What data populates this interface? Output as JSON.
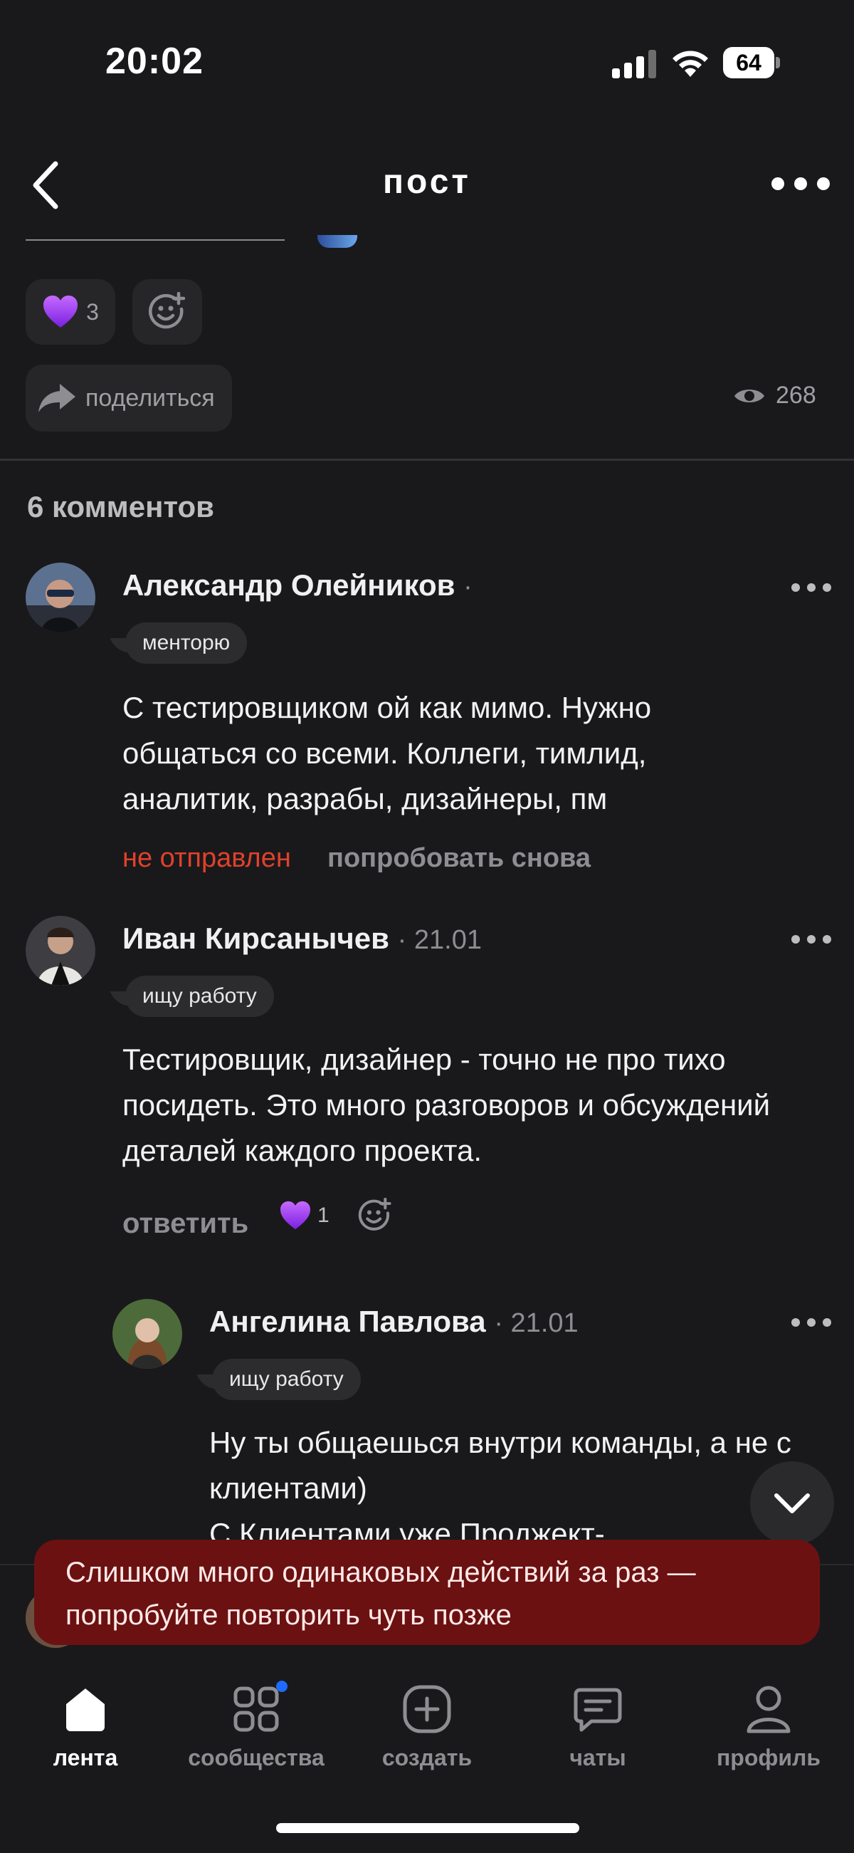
{
  "status_bar": {
    "time": "20:02",
    "battery": "64"
  },
  "header": {
    "title": "пост"
  },
  "post": {
    "likes": "3",
    "share_label": "поделиться",
    "views": "268"
  },
  "comments_section": {
    "count_label": "6 комментов"
  },
  "comments": [
    {
      "author": "Александр Олейников",
      "meta": "·",
      "tag": "менторю",
      "text": "С тестировщиком ой как мимо. Нужно общаться со всеми. Коллеги, тимлид, аналитик, разрабы, дизайнеры, пм",
      "status": "не отправлен",
      "retry_label": "попробовать снова"
    },
    {
      "author": "Иван Кирсанычев",
      "meta": "· 21.01",
      "tag": "ищу работу",
      "text": "Тестировщик, дизайнер - точно не про тихо посидеть. Это много разговоров и обсуждений деталей каждого проекта.",
      "reply_label": "ответить",
      "likes": "1"
    },
    {
      "author": "Ангелина Павлова",
      "meta": "· 21.01",
      "tag": "ищу работу",
      "text": "Ну ты общаешься внутри команды, а не с клиентами)\nС Клиентами уже Проджект-"
    }
  ],
  "toast": {
    "message": "Слишком много одинаковых действий за раз — попробуйте повторить чуть позже"
  },
  "tabbar": {
    "tabs": [
      {
        "label": "лента",
        "icon": "home-icon",
        "active": true
      },
      {
        "label": "сообщества",
        "icon": "grid-icon",
        "active": false
      },
      {
        "label": "создать",
        "icon": "plus-square-icon",
        "active": false
      },
      {
        "label": "чаты",
        "icon": "chat-icon",
        "active": false
      },
      {
        "label": "профиль",
        "icon": "profile-icon",
        "active": false
      }
    ]
  },
  "colors": {
    "background": "#19191b",
    "heart": "#9b3cf5",
    "error": "#e0412b",
    "toast_bg": "#6b1111",
    "badge": "#1e6bff"
  }
}
